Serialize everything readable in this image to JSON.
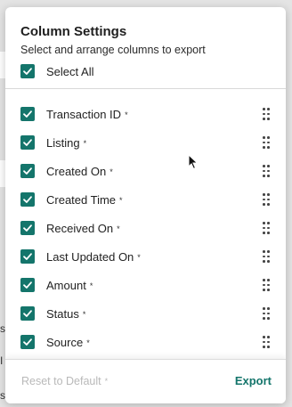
{
  "panel": {
    "title": "Column Settings",
    "subtitle": "Select and arrange columns to export",
    "select_all": {
      "label": "Select All",
      "checked": true
    }
  },
  "columns": [
    {
      "label": "Transaction ID",
      "required_marker": "*",
      "checked": true
    },
    {
      "label": "Listing",
      "required_marker": "*",
      "checked": true
    },
    {
      "label": "Created On",
      "required_marker": "*",
      "checked": true
    },
    {
      "label": "Created Time",
      "required_marker": "*",
      "checked": true
    },
    {
      "label": "Received On",
      "required_marker": "*",
      "checked": true
    },
    {
      "label": "Last Updated On",
      "required_marker": "*",
      "checked": true
    },
    {
      "label": "Amount",
      "required_marker": "*",
      "checked": true
    },
    {
      "label": "Status",
      "required_marker": "*",
      "checked": true
    },
    {
      "label": "Source",
      "required_marker": "*",
      "checked": true
    }
  ],
  "footer": {
    "reset_label": "Reset to Default",
    "reset_marker": "*",
    "export_label": "Export"
  },
  "background": {
    "fragments": [
      "st",
      "st",
      "I",
      "st"
    ]
  },
  "colors": {
    "accent": "#14756b",
    "disabled_text": "#b9b9b9",
    "overlay_bg": "#e4e4e4"
  },
  "icons": {
    "checkbox": "checkmark-icon",
    "drag": "drag-handle-icon",
    "cursor": "mouse-pointer-icon"
  }
}
